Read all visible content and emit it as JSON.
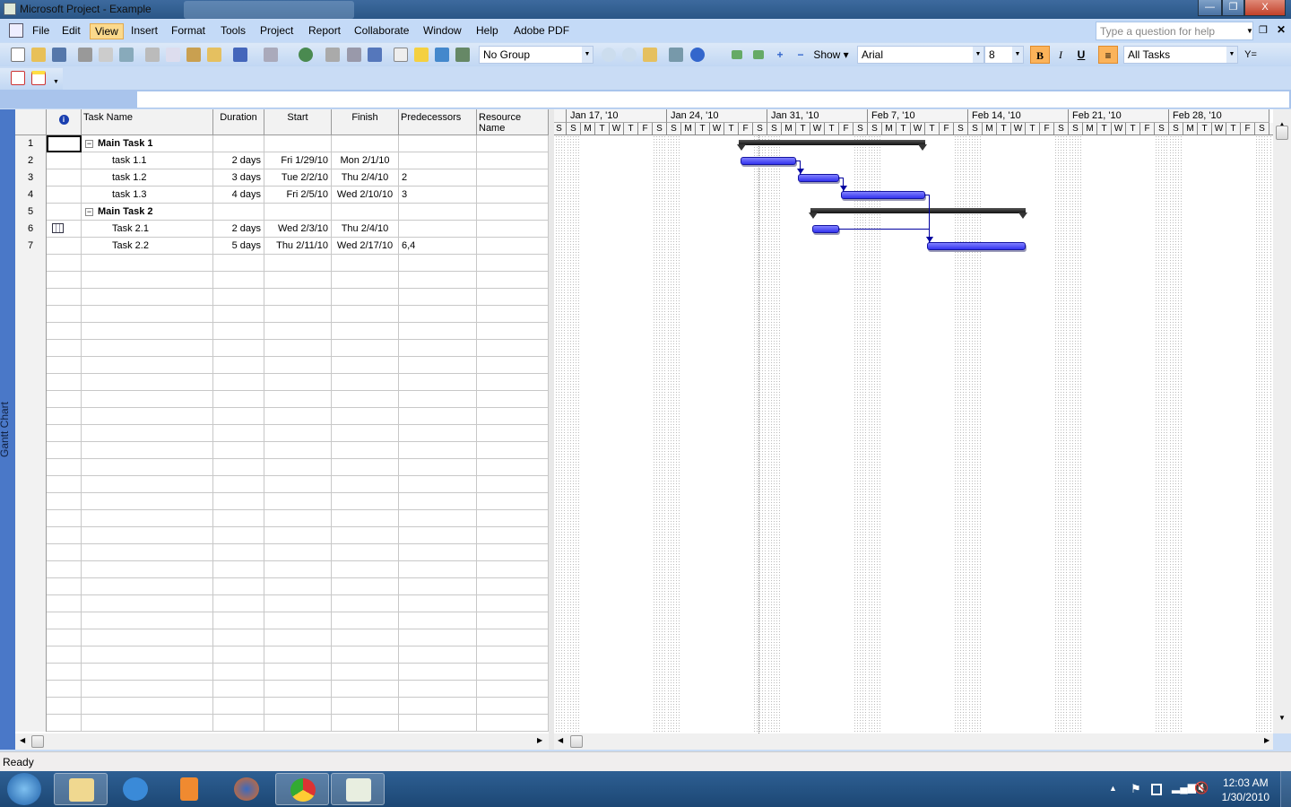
{
  "window": {
    "title": "Microsoft Project - Example",
    "minimize": "—",
    "restore": "❐",
    "close": "X"
  },
  "menu": [
    "File",
    "Edit",
    "View",
    "Insert",
    "Format",
    "Tools",
    "Project",
    "Report",
    "Collaborate",
    "Window",
    "Help",
    "Adobe PDF"
  ],
  "menu_active": "View",
  "help_placeholder": "Type a question for help",
  "toolbar": {
    "group": "No Group",
    "show": "Show ▾",
    "font": "Arial",
    "size": "8",
    "bold": "B",
    "italic": "I",
    "underline": "U",
    "filter": "All Tasks"
  },
  "view_bar": "Gantt Chart",
  "columns": [
    "Task Name",
    "Duration",
    "Start",
    "Finish",
    "Predecessors",
    "Resource Name"
  ],
  "tasks": [
    {
      "id": "1",
      "name": "Main Task 1",
      "summary": true,
      "duration": "",
      "start": "",
      "finish": "",
      "pred": "",
      "bar_start": "1/29/10",
      "bar_finish": "2/10/10"
    },
    {
      "id": "2",
      "name": "task 1.1",
      "duration": "2 days",
      "start": "Fri 1/29/10",
      "finish": "Mon 2/1/10",
      "pred": ""
    },
    {
      "id": "3",
      "name": "task 1.2",
      "duration": "3 days",
      "start": "Tue 2/2/10",
      "finish": "Thu 2/4/10",
      "pred": "2"
    },
    {
      "id": "4",
      "name": "task 1.3",
      "duration": "4 days",
      "start": "Fri 2/5/10",
      "finish": "Wed 2/10/10",
      "pred": "3"
    },
    {
      "id": "5",
      "name": "Main Task 2",
      "summary": true,
      "duration": "",
      "start": "",
      "finish": "",
      "pred": "",
      "bar_start": "2/3/10",
      "bar_finish": "2/17/10"
    },
    {
      "id": "6",
      "name": "Task 2.1",
      "duration": "2 days",
      "start": "Wed 2/3/10",
      "finish": "Thu 2/4/10",
      "pred": "",
      "indicator": "calendar-icon"
    },
    {
      "id": "7",
      "name": "Task 2.2",
      "duration": "5 days",
      "start": "Thu 2/11/10",
      "finish": "Wed 2/17/10",
      "pred": "6,4"
    }
  ],
  "timescale": {
    "weeks": [
      "Jan 17, '10",
      "Jan 24, '10",
      "Jan 31, '10",
      "Feb 7, '10",
      "Feb 14, '10",
      "Feb 21, '10",
      "Feb 28, '10"
    ],
    "first_day": "1/16/10",
    "day_letters": [
      "S",
      "S",
      "M",
      "T",
      "W",
      "T",
      "F"
    ]
  },
  "colors": {
    "task_bar": "#3333ee",
    "summary_bar": "#222222"
  },
  "status": "Ready",
  "clock": {
    "time": "12:03 AM",
    "date": "1/30/2010"
  }
}
